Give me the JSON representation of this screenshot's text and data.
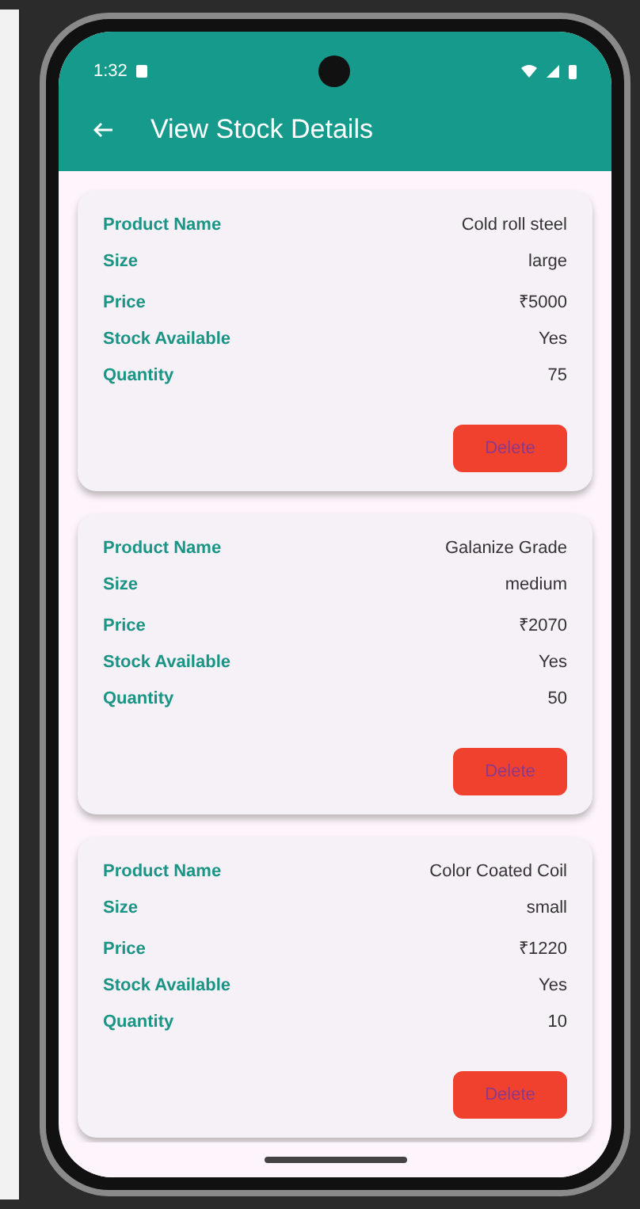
{
  "status_bar": {
    "time": "1:32"
  },
  "app_bar": {
    "title": "View Stock Details"
  },
  "stocks": [
    {
      "rows": [
        {
          "label": "Product Name",
          "value": "Cold roll steel"
        },
        {
          "label": "Size",
          "value": "large"
        },
        {
          "label": "Price",
          "value": "₹5000"
        },
        {
          "label": "Stock Available",
          "value": "Yes"
        },
        {
          "label": "Quantity",
          "value": "75"
        }
      ],
      "button": "Delete"
    },
    {
      "rows": [
        {
          "label": "Product Name",
          "value": "Galanize Grade"
        },
        {
          "label": "Size",
          "value": "medium"
        },
        {
          "label": "Price",
          "value": "₹2070"
        },
        {
          "label": "Stock Available",
          "value": "Yes"
        },
        {
          "label": "Quantity",
          "value": "50"
        }
      ],
      "button": "Delete"
    },
    {
      "rows": [
        {
          "label": "Product Name",
          "value": "Color Coated Coil"
        },
        {
          "label": "Size",
          "value": "small"
        },
        {
          "label": "Price",
          "value": "₹1220"
        },
        {
          "label": "Stock Available",
          "value": "Yes"
        },
        {
          "label": "Quantity",
          "value": "10"
        }
      ],
      "button": "Delete"
    }
  ]
}
